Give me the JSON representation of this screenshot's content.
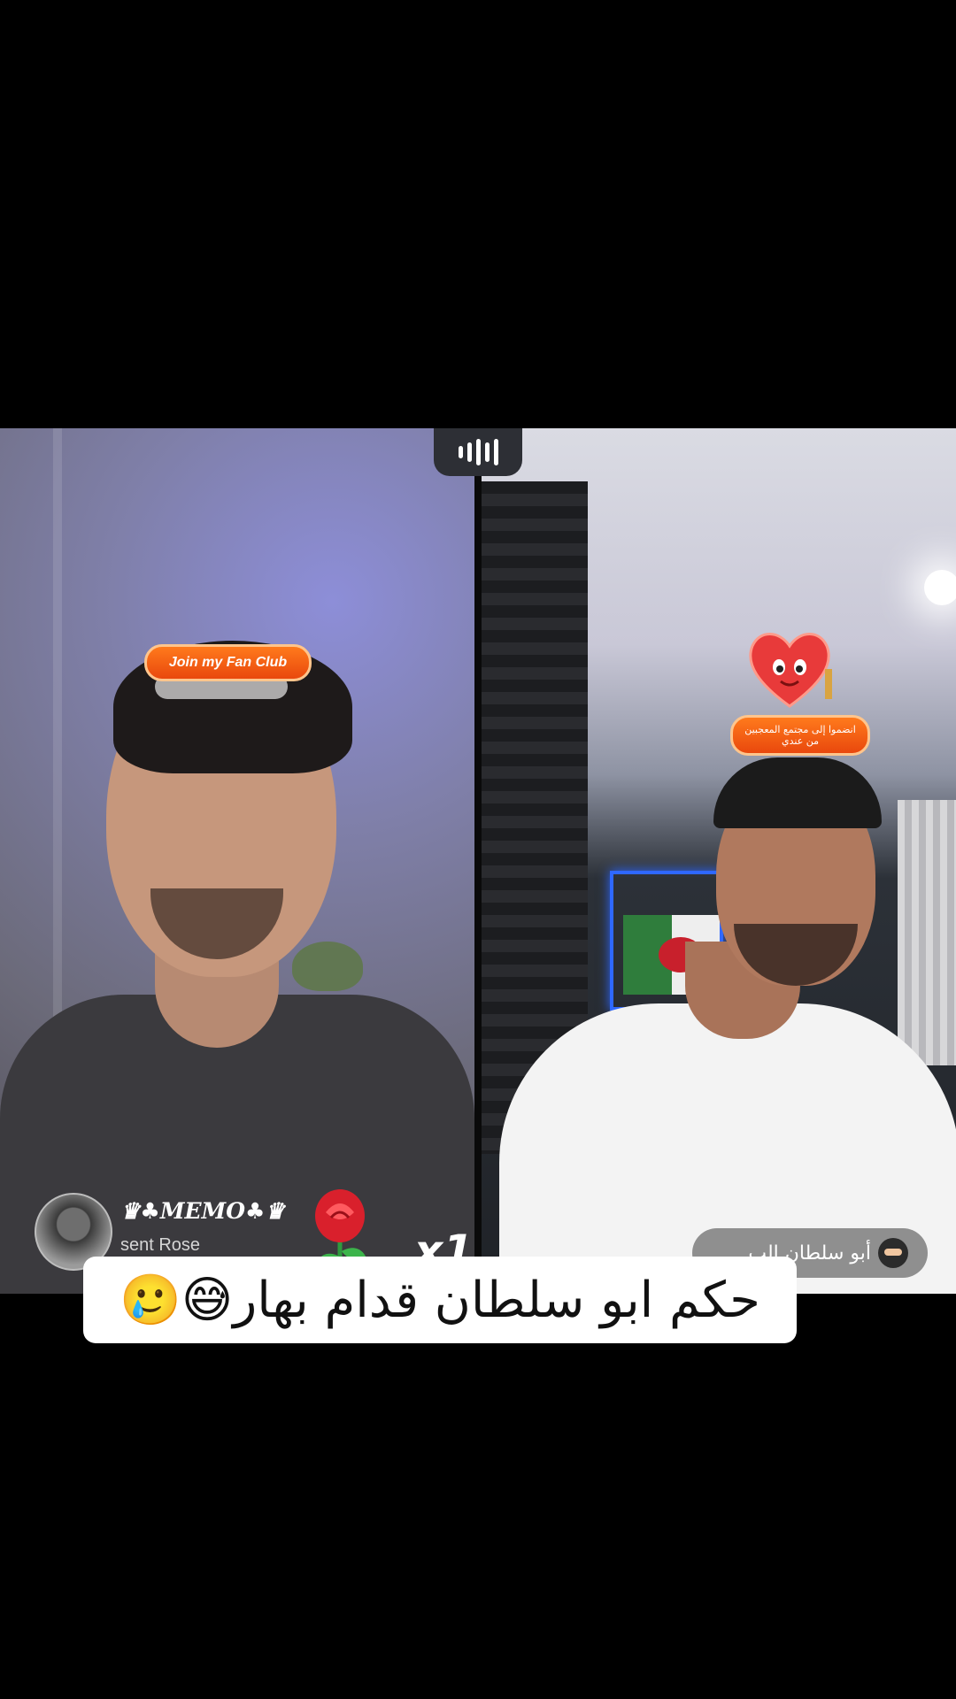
{
  "left_stream": {
    "fan_club_label": "Join my Fan Club",
    "gift": {
      "sender": "♛♣MEMO♣♛",
      "action": "sent Rose",
      "count": "x1",
      "icon": "rose-icon"
    }
  },
  "right_stream": {
    "fan_club_label_line1": "انضموا إلى مجتمع المعجبين",
    "fan_club_label_line2": "من عندي",
    "host_name": "أبو سلطان الب",
    "host_icon": "ninja-icon"
  },
  "caption": "حكم ابو سلطان قدام بهار😅🥲",
  "colors": {
    "badge_orange": "#e9480d",
    "background": "#000000",
    "caption_bg": "#ffffff"
  }
}
